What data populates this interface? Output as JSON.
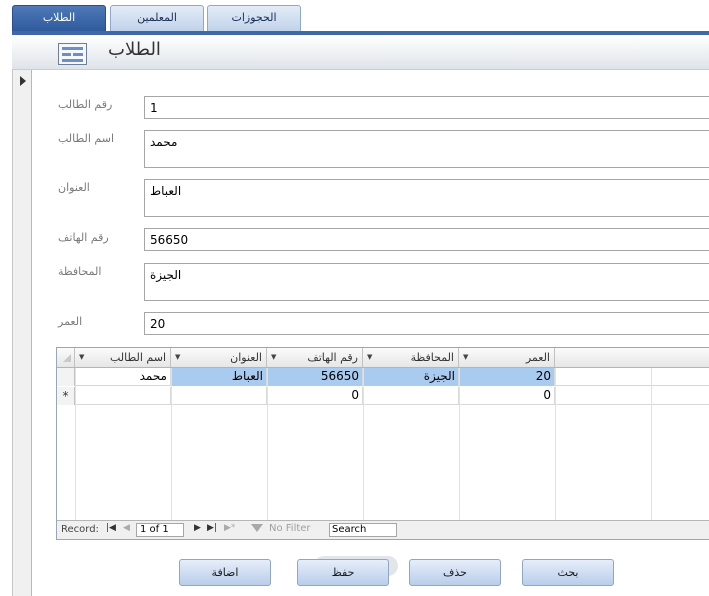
{
  "tabs": [
    {
      "label": "الطلاب",
      "active": true
    },
    {
      "label": "المعلمين",
      "active": false
    },
    {
      "label": "الحجوزات",
      "active": false
    }
  ],
  "form": {
    "title": "الطلاب",
    "icon": "form-icon"
  },
  "fields": {
    "student_id": {
      "label": "رقم الطالب",
      "value": "1"
    },
    "student_name": {
      "label": "اسم الطالب",
      "value": "محمد"
    },
    "address": {
      "label": "العنوان",
      "value": "العباط"
    },
    "phone": {
      "label": "رقم الهاتف",
      "value": "56650"
    },
    "governorate": {
      "label": "المحافظة",
      "value": "الجيزة"
    },
    "age": {
      "label": "العمر",
      "value": "20"
    }
  },
  "datasheet": {
    "columns": [
      "اسم الطالب",
      "العنوان",
      "رقم الهاتف",
      "المحافظة",
      "العمر"
    ],
    "rows": [
      {
        "name": "محمد",
        "address": "العباط",
        "phone": "56650",
        "governorate": "الجيزة",
        "age": "20"
      }
    ],
    "new_row": {
      "marker": "*",
      "phone": "0",
      "age": "0"
    }
  },
  "navbar": {
    "record_label": "Record:",
    "first": "|◀",
    "prev": "◀",
    "position": "1 of 1",
    "next": "▶",
    "last": "▶|",
    "new": "▶*",
    "filter_label": "No Filter",
    "search_placeholder": "Search"
  },
  "buttons": {
    "add": "اضافة",
    "save": "حفظ",
    "delete": "حذف",
    "search": "بحث"
  },
  "colors": {
    "accent": "#3f68a8",
    "selection": "#a9cbef"
  }
}
